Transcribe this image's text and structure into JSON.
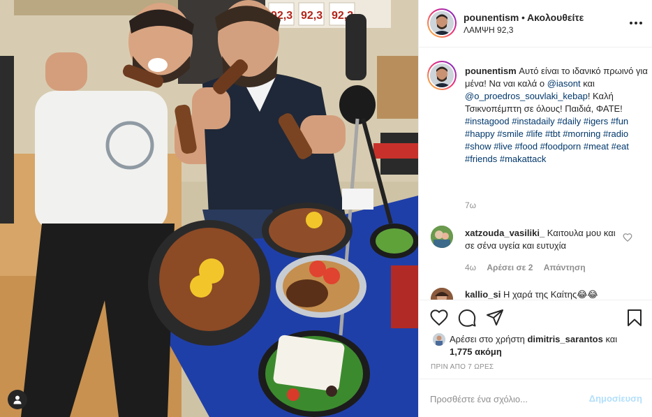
{
  "header": {
    "username": "pounentism",
    "separator": "•",
    "follow_status": "Ακολουθείτε",
    "location": "ΛΑΜΨΗ 92,3"
  },
  "photo": {
    "sign_text": [
      "92,3",
      "92,3",
      "92,3"
    ]
  },
  "caption": {
    "username": "pounentism",
    "text_1": "Αυτό είναι το ιδανικό πρωινό για μένα! Να ναι καλά ο ",
    "mention_1": "@iasont",
    "text_2": " και ",
    "mention_2": "@o_proedros_souvlaki_kebap",
    "text_3": "! Καλή Τσικνοπέμπτη σε όλους! Παιδιά, ΦΑΤΕ! ",
    "hashtags": "#instagood #instadaily #daily #igers #fun #happy #smile #life #tbt #morning #radio #show #live #food #foodporn #meat #eat #friends #makattack",
    "time": "7ω"
  },
  "comments": [
    {
      "username": "xatzouda_vasiliki_",
      "text": "Καιτουλα μου και σε σένα υγεία και ευτυχία",
      "time": "4ω",
      "likes": "Αρέσει σε 2",
      "reply": "Απάντηση"
    },
    {
      "username": "kallio_si",
      "text": "Η χαρά της Καίτης😂😂"
    }
  ],
  "likes": {
    "prefix": "Αρέσει στο χρήστη ",
    "user": "dimitris_sarantos",
    "mid": " και",
    "count": "1,775 ακόμη"
  },
  "post_date": "ΠΡΙΝ ΑΠΟ 7 ΩΡΕΣ",
  "add_comment": {
    "placeholder": "Προσθέστε ένα σχόλιο...",
    "post_label": "Δημοσίευση"
  },
  "icons": {
    "like": "heart-icon",
    "comment": "comment-icon",
    "share": "share-icon",
    "save": "bookmark-icon",
    "more": "more-icon",
    "tag": "user-tag-icon"
  },
  "colors": {
    "link": "#00376b",
    "muted": "#8e8e8e",
    "post_button": "#b2dffc",
    "border": "#efefef"
  }
}
